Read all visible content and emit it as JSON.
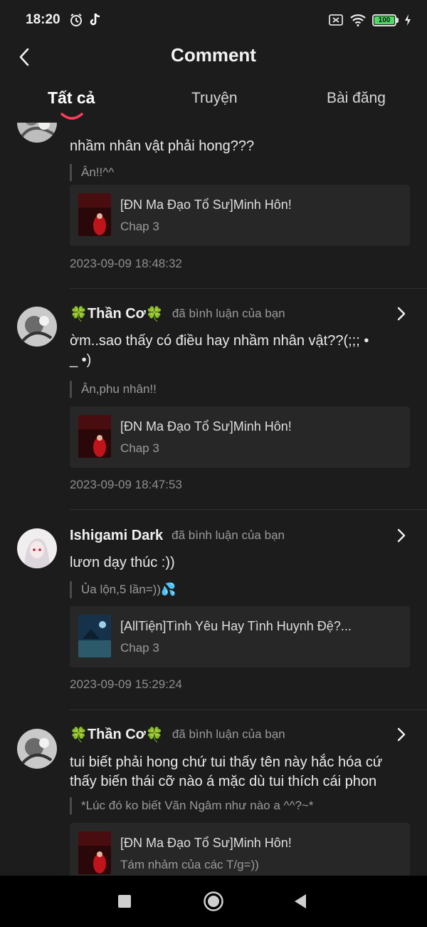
{
  "status_bar": {
    "time": "18:20",
    "battery": "100"
  },
  "header": {
    "title": "Comment"
  },
  "tabs": [
    {
      "label": "Tất cả"
    },
    {
      "label": "Truyện"
    },
    {
      "label": "Bài đăng"
    }
  ],
  "comments": [
    {
      "text": "nhầm nhân vật phải hong???",
      "quote": "Ân!!^^",
      "story": {
        "title": "[ĐN Ma Đạo Tổ Sư]Minh Hôn!",
        "chapter": "Chap 3"
      },
      "time": "2023-09-09 18:48:32"
    },
    {
      "user": "Thần Cơ",
      "action": "đã bình luận của bạn",
      "text_line1": "ờm..sao thấy có điều hay nhầm nhân vật??(;;; •",
      "text_line2": "_ •)",
      "quote": "Ân,phu nhân!!",
      "story": {
        "title": "[ĐN Ma Đạo Tổ Sư]Minh Hôn!",
        "chapter": "Chap 3"
      },
      "time": "2023-09-09 18:47:53"
    },
    {
      "user": "Ishigami Dark",
      "action": "đã bình luận của bạn",
      "text": "lươn dạy thúc :))",
      "quote": "Ủa lộn,5 lần=))💦",
      "story": {
        "title": "[AllTiện]Tình Yêu Hay Tình Huynh Đệ?...",
        "chapter": "Chap 3"
      },
      "time": "2023-09-09 15:29:24"
    },
    {
      "user": "Thần Cơ",
      "action": "đã bình luận của bạn",
      "text_line1": "tui biết phải hong chứ tui thấy tên này hắc hóa cứ",
      "text_line2": "thấy biến thái cỡ nào á mặc dù tui thích cái phon",
      "quote": "*Lúc đó ko biết Vãn Ngâm như nào a ^^?~*",
      "story": {
        "title": "[ĐN Ma Đạo Tổ Sư]Minh Hôn!",
        "chapter": "Tám nhảm của các T/g=))"
      }
    }
  ],
  "icons": {
    "clover": "🍀",
    "back": "chevron-left-icon",
    "more": "chevron-right-icon",
    "nav": [
      "recents-square-icon",
      "home-circle-icon",
      "back-triangle-icon"
    ]
  },
  "colors": {
    "background": "#1c1c1c",
    "card": "#272727",
    "tab_indicator": "#ff3b5c",
    "clover": "#39b54a"
  }
}
